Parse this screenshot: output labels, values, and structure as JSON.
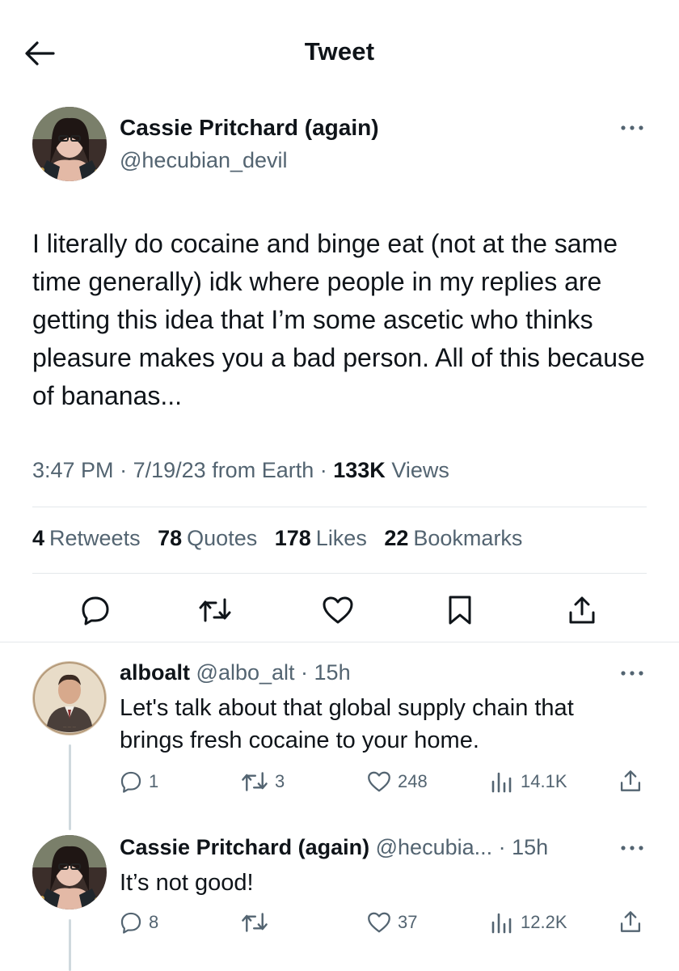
{
  "header": {
    "title": "Tweet",
    "back_icon": "arrow-left-icon"
  },
  "main_tweet": {
    "author_name": "Cassie Pritchard (again)",
    "author_handle": "@hecubian_devil",
    "text": "I literally do cocaine and binge eat (not at the same time generally) idk where people in my replies are getting this idea that I’m some ascetic who thinks pleasure makes you a bad person. All of this because of bananas...",
    "time": "3:47 PM",
    "date": "7/19/23",
    "source": "from Earth",
    "views_count": "133K",
    "views_label": "Views",
    "stats": {
      "retweets_count": "4",
      "retweets_label": "Retweets",
      "quotes_count": "78",
      "quotes_label": "Quotes",
      "likes_count": "178",
      "likes_label": "Likes",
      "bookmarks_count": "22",
      "bookmarks_label": "Bookmarks"
    },
    "actions": [
      "reply-icon",
      "retweet-icon",
      "like-icon",
      "bookmark-icon",
      "share-icon"
    ]
  },
  "replies": [
    {
      "author_name": "alboalt",
      "author_handle": "@albo_alt",
      "time": "15h",
      "text": "Let's talk about that global supply chain that brings fresh cocaine to your home.",
      "reply_count": "1",
      "retweet_count": "3",
      "like_count": "248",
      "view_count": "14.1K"
    },
    {
      "author_name": "Cassie Pritchard (again)",
      "author_handle": "@hecubia...",
      "time": "15h",
      "text": "It’s not good!",
      "reply_count": "8",
      "retweet_count": "",
      "like_count": "37",
      "view_count": "12.2K"
    }
  ],
  "colors": {
    "text_primary": "#0f1419",
    "text_secondary": "#536471",
    "divider": "#e4e8eb"
  }
}
